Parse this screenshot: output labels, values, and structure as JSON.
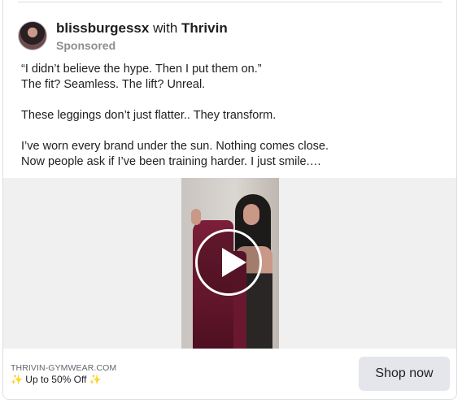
{
  "post": {
    "author": "blissburgessx",
    "with_text": "with",
    "partner": "Thrivin",
    "sponsored": "Sponsored",
    "body_lines": [
      "“I didn’t believe the hype. Then I put them on.”",
      "The fit? Seamless. The lift? Unreal.",
      "",
      "These leggings don’t just flatter.. They transform.",
      "",
      "I’ve worn every brand under the sun. Nothing comes close.",
      "Now people ask if I’ve been training harder. I just smile.…"
    ]
  },
  "media": {
    "type": "video",
    "icon": "play-icon"
  },
  "footer": {
    "domain": "THRIVIN-GYMWEAR.COM",
    "promo": "✨ Up to 50% Off ✨",
    "cta_label": "Shop now"
  }
}
